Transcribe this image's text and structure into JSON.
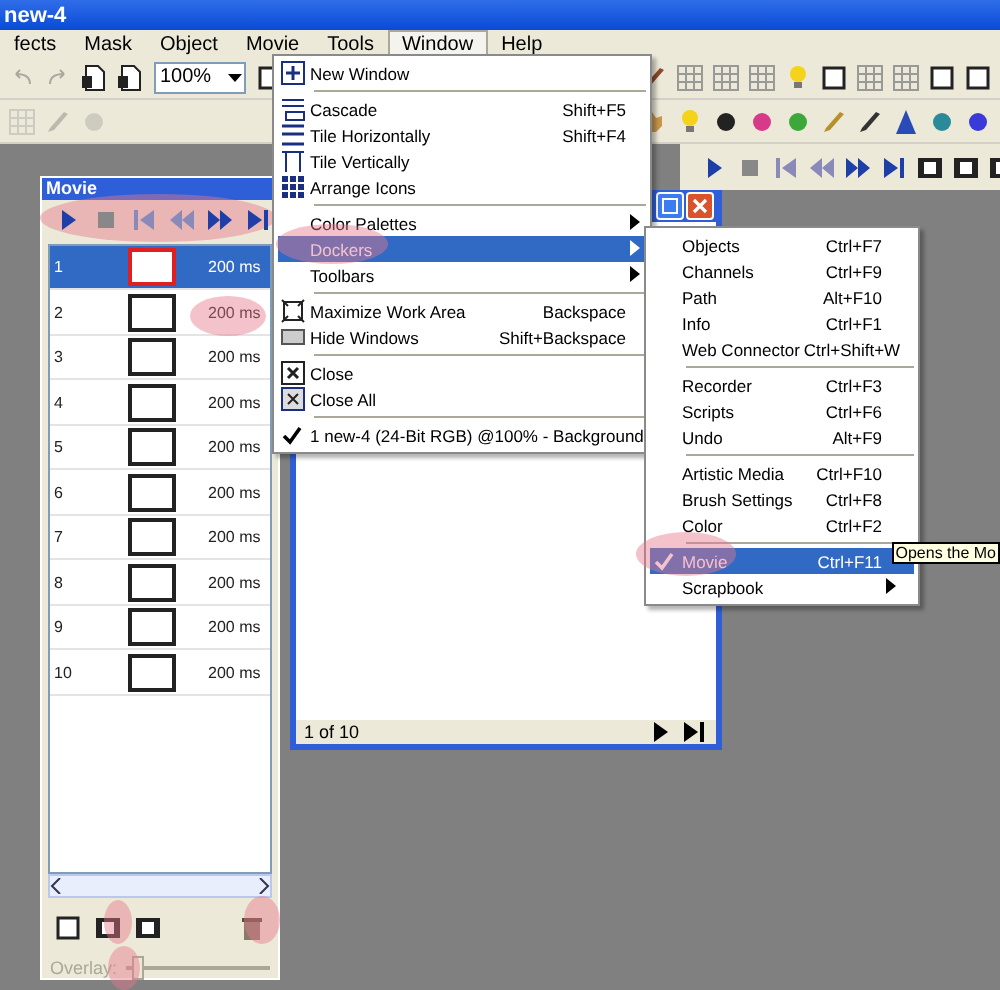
{
  "window": {
    "title": "new-4"
  },
  "menubar": [
    {
      "label": "fects",
      "selected": false
    },
    {
      "label": "Mask",
      "selected": false
    },
    {
      "label": "Object",
      "selected": false
    },
    {
      "label": "Movie",
      "selected": false
    },
    {
      "label": "Tools",
      "selected": false
    },
    {
      "label": "Window",
      "selected": true
    },
    {
      "label": "Help",
      "selected": false
    }
  ],
  "toolbar": {
    "zoom": "100%"
  },
  "window_menu": [
    {
      "kind": "item",
      "label": "New Window",
      "selected": false
    },
    {
      "kind": "separator"
    },
    {
      "kind": "item",
      "label": "Cascade",
      "shortcut": "Shift+F5",
      "selected": false
    },
    {
      "kind": "item",
      "label": "Tile Horizontally",
      "shortcut": "Shift+F4",
      "selected": false
    },
    {
      "kind": "item",
      "label": "Tile Vertically",
      "selected": false
    },
    {
      "kind": "item",
      "label": "Arrange Icons",
      "selected": false
    },
    {
      "kind": "separator"
    },
    {
      "kind": "item",
      "label": "Color Palettes",
      "submenu": true,
      "selected": false
    },
    {
      "kind": "item",
      "label": "Dockers",
      "submenu": true,
      "selected": true
    },
    {
      "kind": "item",
      "label": "Toolbars",
      "submenu": true,
      "selected": false
    },
    {
      "kind": "separator"
    },
    {
      "kind": "item",
      "label": "Maximize Work Area",
      "shortcut": "Backspace",
      "selected": false
    },
    {
      "kind": "item",
      "label": "Hide Windows",
      "shortcut": "Shift+Backspace",
      "selected": false
    },
    {
      "kind": "separator"
    },
    {
      "kind": "item",
      "label": "Close",
      "selected": false
    },
    {
      "kind": "item",
      "label": "Close All",
      "selected": false
    },
    {
      "kind": "separator"
    },
    {
      "kind": "item",
      "label": "1  new-4 (24-Bit RGB) @100% - Background",
      "checked": true,
      "selected": false
    }
  ],
  "dockers_menu": [
    {
      "kind": "item",
      "label": "Objects",
      "shortcut": "Ctrl+F7",
      "selected": false
    },
    {
      "kind": "item",
      "label": "Channels",
      "shortcut": "Ctrl+F9",
      "selected": false
    },
    {
      "kind": "item",
      "label": "Path",
      "shortcut": "Alt+F10",
      "selected": false
    },
    {
      "kind": "item",
      "label": "Info",
      "shortcut": "Ctrl+F1",
      "selected": false
    },
    {
      "kind": "item",
      "label": "Web Connector",
      "shortcut": "Ctrl+Shift+W",
      "selected": false
    },
    {
      "kind": "separator"
    },
    {
      "kind": "item",
      "label": "Recorder",
      "shortcut": "Ctrl+F3",
      "selected": false
    },
    {
      "kind": "item",
      "label": "Scripts",
      "shortcut": "Ctrl+F6",
      "selected": false
    },
    {
      "kind": "item",
      "label": "Undo",
      "shortcut": "Alt+F9",
      "selected": false
    },
    {
      "kind": "separator"
    },
    {
      "kind": "item",
      "label": "Artistic Media",
      "shortcut": "Ctrl+F10",
      "selected": false
    },
    {
      "kind": "item",
      "label": "Brush Settings",
      "shortcut": "Ctrl+F8",
      "selected": false
    },
    {
      "kind": "item",
      "label": "Color",
      "shortcut": "Ctrl+F2",
      "selected": false
    },
    {
      "kind": "separator"
    },
    {
      "kind": "item",
      "label": "Movie",
      "shortcut": "Ctrl+F11",
      "checked": true,
      "selected": true
    },
    {
      "kind": "item",
      "label": "Scrapbook",
      "submenu": true,
      "selected": false
    }
  ],
  "tooltip": "Opens the Mo",
  "movie_docker": {
    "title": "Movie",
    "frames": [
      {
        "number": "1",
        "delay": "200 ms",
        "selected": true
      },
      {
        "number": "2",
        "delay": "200 ms",
        "selected": false
      },
      {
        "number": "3",
        "delay": "200 ms",
        "selected": false
      },
      {
        "number": "4",
        "delay": "200 ms",
        "selected": false
      },
      {
        "number": "5",
        "delay": "200 ms",
        "selected": false
      },
      {
        "number": "6",
        "delay": "200 ms",
        "selected": false
      },
      {
        "number": "7",
        "delay": "200 ms",
        "selected": false
      },
      {
        "number": "8",
        "delay": "200 ms",
        "selected": false
      },
      {
        "number": "9",
        "delay": "200 ms",
        "selected": false
      },
      {
        "number": "10",
        "delay": "200 ms",
        "selected": false
      }
    ],
    "overlay": {
      "label": "Overlay:",
      "disabled": true,
      "level": 0.05
    }
  },
  "document": {
    "status": "1 of 10"
  }
}
